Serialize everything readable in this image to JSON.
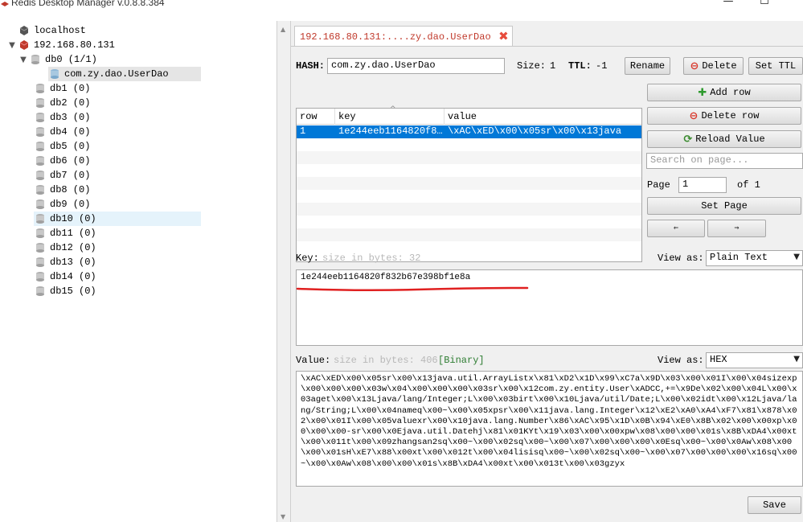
{
  "window": {
    "title": "Redis Desktop Manager v.0.8.8.384",
    "min": "—",
    "max": "☐"
  },
  "tree": {
    "servers": [
      {
        "label": "localhost"
      },
      {
        "label": "192.168.80.131"
      }
    ],
    "db0": {
      "label": "db0  (1/1)"
    },
    "key": {
      "label": "com.zy.dao.UserDao"
    },
    "dbs": [
      "db1  (0)",
      "db2  (0)",
      "db3  (0)",
      "db4  (0)",
      "db5  (0)",
      "db6  (0)",
      "db7  (0)",
      "db8  (0)",
      "db9  (0)",
      "db10  (0)",
      "db11  (0)",
      "db12  (0)",
      "db13  (0)",
      "db14  (0)",
      "db15  (0)"
    ]
  },
  "tab": {
    "label": "192.168.80.131:....zy.dao.UserDao"
  },
  "header": {
    "type_label": "HASH:",
    "key_name": "com.zy.dao.UserDao",
    "size_label": "Size:",
    "size_value": "1",
    "ttl_label": "TTL:",
    "ttl_value": "-1",
    "rename": "Rename",
    "delete": "Delete",
    "set_ttl": "Set TTL"
  },
  "table": {
    "columns": [
      "row",
      "key",
      "value"
    ],
    "rows": [
      {
        "row": "1",
        "key": "1e244eeb1164820f8…",
        "value": "\\xAC\\xED\\x00\\x05sr\\x00\\x13java.…"
      }
    ]
  },
  "side": {
    "add_row": "Add row",
    "delete_row": "Delete row",
    "reload": "Reload Value",
    "search_placeholder": "Search on page...",
    "page_label": "Page",
    "page_value": "1",
    "of_label": "of 1",
    "set_page": "Set Page",
    "prev": "⇐",
    "next": "⇒"
  },
  "key_section": {
    "label": "Key:",
    "hint": "size in bytes: 32",
    "view_as_label": "View as:",
    "view_as": "Plain Text",
    "value": "1e244eeb1164820f832b67e398bf1e8a"
  },
  "value_section": {
    "label": "Value:",
    "hint": "size in bytes: 406",
    "binary": "[Binary]",
    "view_as_label": "View as:",
    "view_as": "HEX",
    "value": "\\xAC\\xED\\x00\\x05sr\\x00\\x13java.util.ArrayListx\\x81\\xD2\\x1D\\x99\\xC7a\\x9D\\x03\\x00\\x01I\\x00\\x04sizexp\\x00\\x00\\x00\\x03w\\x04\\x00\\x00\\x00\\x03sr\\x00\\x12com.zy.entity.User\\xADCC,+=\\x9De\\x02\\x00\\x04L\\x00\\x03aget\\x00\\x13Ljava/lang/Integer;L\\x00\\x03birt\\x00\\x10Ljava/util/Date;L\\x00\\x02idt\\x00\\x12Ljava/lang/String;L\\x00\\x04nameq\\x00~\\x00\\x05xpsr\\x00\\x11java.lang.Integer\\x12\\xE2\\xA0\\xA4\\xF7\\x81\\x878\\x02\\x00\\x01I\\x00\\x05valuexr\\x00\\x10java.lang.Number\\x86\\xAC\\x95\\x1D\\x0B\\x94\\xE0\\x8B\\x02\\x00\\x00xp\\x00\\x00\\x00-sr\\x00\\x0Ejava.util.Datehj\\x81\\x01KYt\\x19\\x03\\x00\\x00xpw\\x08\\x00\\x00\\x01s\\x8B\\xDA4\\x00xt\\x00\\x011t\\x00\\x09zhangsan2sq\\x00~\\x00\\x02sq\\x00~\\x00\\x07\\x00\\x00\\x00\\x0Esq\\x00~\\x00\\x0Aw\\x08\\x00\\x00\\x01sH\\xE7\\x88\\x00xt\\x00\\x012t\\x00\\x04lisisq\\x00~\\x00\\x02sq\\x00~\\x00\\x07\\x00\\x00\\x00\\x16sq\\x00~\\x00\\x0Aw\\x08\\x00\\x00\\x01s\\x8B\\xDA4\\x00xt\\x00\\x013t\\x00\\x03gzyx",
    "save": "Save"
  },
  "colors": {
    "accent_red": "#c0392b",
    "selection_blue": "#0078d7",
    "underline_red": "#e02020",
    "binary_green": "#2e7d32"
  }
}
